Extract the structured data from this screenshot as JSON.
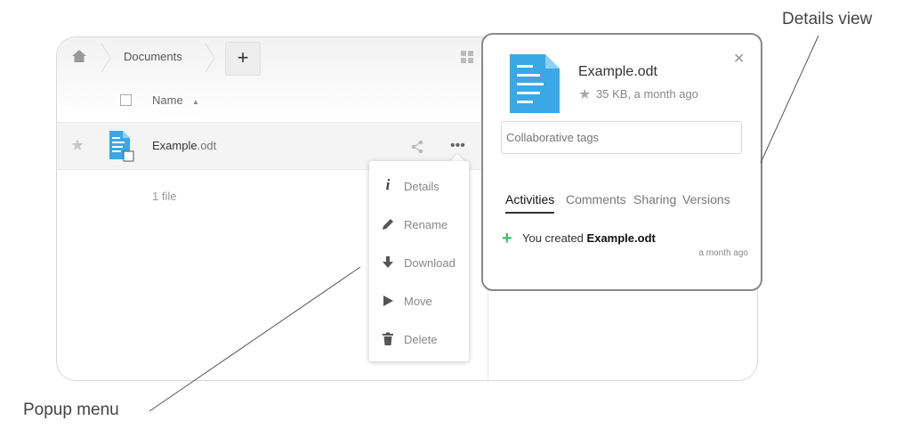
{
  "breadcrumb": {
    "folder": "Documents",
    "add_label": "+"
  },
  "file_list": {
    "column_name": "Name",
    "file": {
      "base": "Example",
      "ext": ".odt"
    },
    "count": "1 file"
  },
  "popup_menu": {
    "items": [
      {
        "label": "Details",
        "icon": "info-icon"
      },
      {
        "label": "Rename",
        "icon": "pencil-icon"
      },
      {
        "label": "Download",
        "icon": "download-icon"
      },
      {
        "label": "Move",
        "icon": "move-icon"
      },
      {
        "label": "Delete",
        "icon": "trash-icon"
      }
    ]
  },
  "details": {
    "title": "Example.odt",
    "meta": "35 KB, a month ago",
    "tags_placeholder": "Collaborative tags",
    "tabs": [
      "Activities",
      "Comments",
      "Sharing",
      "Versions"
    ],
    "activity": {
      "prefix": "You created",
      "file": "Example.odt",
      "time": "a month ago"
    }
  },
  "callouts": {
    "details": "Details view",
    "popup": "Popup menu"
  },
  "colors": {
    "file_blue": "#3aa7e6",
    "activity_green": "#46ba61"
  }
}
